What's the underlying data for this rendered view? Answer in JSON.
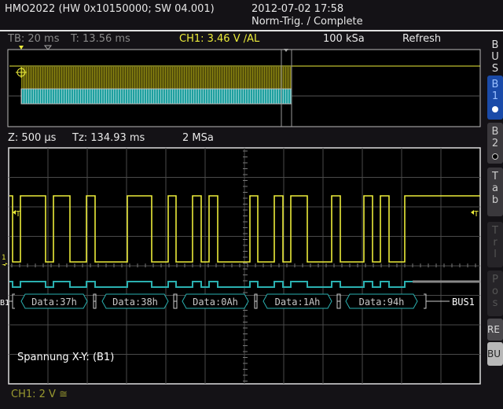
{
  "header": {
    "device": "HMO2022 (HW 0x10150000; SW 04.001)",
    "datetime": "2012-07-02 17:58",
    "trigger_status": "Norm-Trig. / Complete"
  },
  "overview": {
    "timebase": "TB: 20 ms",
    "trigger_time": "T: 13.56 ms",
    "channel_trigger": "CH1: 3.46 V ∕AL",
    "sample_rate": "100 kSa",
    "mode": "Refresh"
  },
  "zoom": {
    "zoom_scale": "Z: 500 µs",
    "zoom_time": "Tz: 134.93 ms",
    "sample_rate": "2 MSa"
  },
  "bus": {
    "label_left": "B1",
    "label_right": "BUS1",
    "frames": [
      "Data:37h",
      "Data:38h",
      "Data:0Ah",
      "Data:1Ah",
      "Data:94h"
    ]
  },
  "annotation": "Spannung X-Y: (B1)",
  "markers": {
    "trigger": "T",
    "ch1": "1"
  },
  "footer": {
    "ch1_scale": "CH1: 2 V ≅"
  },
  "sidebar": {
    "bus": "BUS",
    "b1": "B1",
    "b2": "B2",
    "tab": "Tab",
    "trl": "Trl",
    "pos": "Pos",
    "re": "RE",
    "bu": "BU"
  },
  "colors": {
    "ch1": "#ecec3a",
    "bus": "#2ab0b0",
    "accent": "#1a4aa8"
  }
}
